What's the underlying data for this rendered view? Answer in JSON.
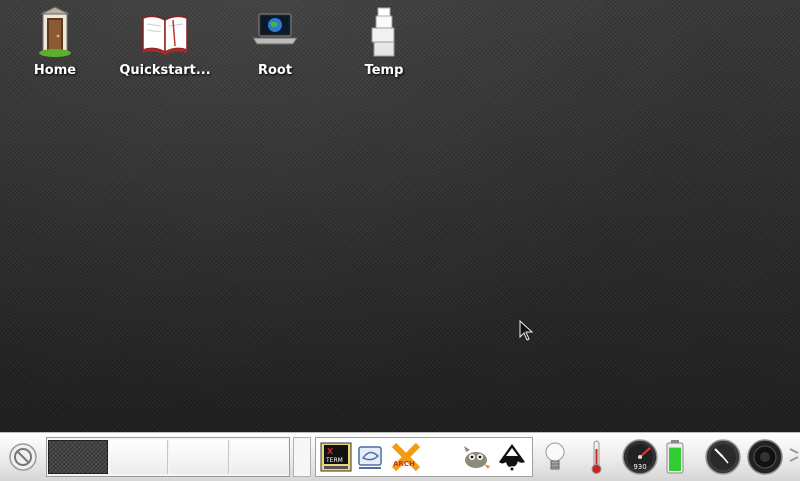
{
  "desktop": {
    "icons": [
      {
        "label": "Home",
        "icon": "home-door-icon"
      },
      {
        "label": "Quickstart...",
        "icon": "open-book-icon"
      },
      {
        "label": "Root",
        "icon": "laptop-globe-icon"
      },
      {
        "label": "Temp",
        "icon": "stacked-boxes-icon"
      }
    ]
  },
  "taskbar": {
    "pager": {
      "desktops": 4,
      "active": 1
    },
    "launchers": [
      {
        "name": "xterm",
        "icon": "xterm-terminal-icon"
      },
      {
        "name": "screenshot",
        "icon": "screenshot-icon"
      },
      {
        "name": "xarchiver",
        "icon": "archive-x-icon"
      },
      {
        "name": "gimp",
        "icon": "gimp-icon"
      },
      {
        "name": "inkscape",
        "icon": "inkscape-icon"
      }
    ],
    "tray": {
      "cpu_gauge_value": "930",
      "battery_level": 0.9
    },
    "colors": {
      "accent_battery": "#33cc33",
      "thermo": "#cc2222"
    }
  }
}
